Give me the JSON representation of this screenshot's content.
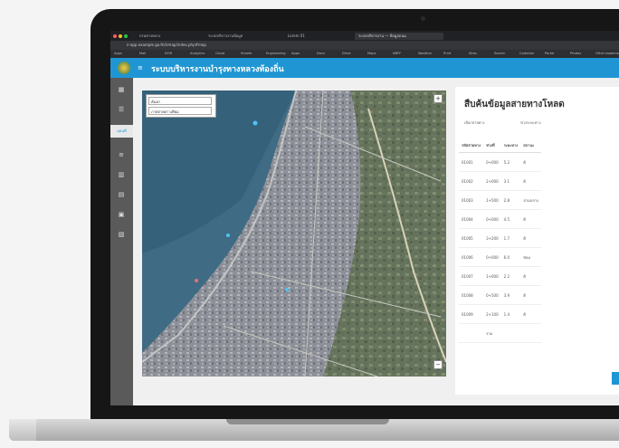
{
  "browser": {
    "tabs": [
      "กรมทางหลวง",
      "ระบบบริหารงานข้อมูล",
      "Lorem 01",
      "ระบบบริหารงาน — ข้อมูลถนน"
    ],
    "url": "ir-app.example.go.th/irmap/index.php#map",
    "bookmarks": [
      "Apps",
      "Mail",
      "DOH",
      "Analytics",
      "Cloud",
      "Sheets",
      "Engineering",
      "Apps",
      "Docs",
      "Drive",
      "Maps",
      "NRFF",
      "Weather",
      "Print",
      "Sites",
      "Search",
      "Calendar",
      "Portal",
      "Photos",
      "Other bookmarks"
    ]
  },
  "app": {
    "title": "ระบบบริหารงานบำรุงทางหลวงท้องถิ่น",
    "menu_icon": "hamburger-icon",
    "logo": "department-seal"
  },
  "sidebar": {
    "items": [
      {
        "icon": "home-icon",
        "glyph": "▦"
      },
      {
        "icon": "layers-icon",
        "glyph": "☰"
      },
      {
        "icon": "map-icon",
        "label": "แผนที่",
        "active": true
      },
      {
        "icon": "road-icon",
        "glyph": "≡"
      },
      {
        "icon": "chart-icon",
        "glyph": "▥"
      },
      {
        "icon": "document-icon",
        "glyph": "▤"
      },
      {
        "icon": "lock-icon",
        "glyph": "▣"
      },
      {
        "icon": "settings-icon",
        "glyph": "▧"
      }
    ]
  },
  "map": {
    "search_placeholder": "ค้นหา",
    "layer_label": "ภาพถ่ายดาวเทียม",
    "zoom_in": "+",
    "zoom_out": "−"
  },
  "panel": {
    "title": "สืบค้นข้อมูลสายทางโหลด",
    "filters": [
      "เลือกสายทาง",
      "ช่วงระยะทาง"
    ],
    "columns": [
      "รหัสสายทาง",
      "ช่วงที่",
      "ระยะทาง",
      "สถานะ"
    ],
    "rows": [
      [
        "01001",
        "0+000",
        "5.2",
        "ดี"
      ],
      [
        "01002",
        "2+000",
        "3.1",
        "ดี"
      ],
      [
        "01003",
        "1+500",
        "2.8",
        "ปานกลาง"
      ],
      [
        "01004",
        "0+000",
        "4.5",
        "ดี"
      ],
      [
        "01005",
        "3+200",
        "1.7",
        "ดี"
      ],
      [
        "01006",
        "0+000",
        "6.0",
        "ซ่อม"
      ],
      [
        "01007",
        "1+000",
        "2.2",
        "ดี"
      ],
      [
        "01008",
        "0+500",
        "3.9",
        "ดี"
      ],
      [
        "01009",
        "2+100",
        "1.4",
        "ดี"
      ],
      [
        "",
        "รวม",
        "",
        ""
      ]
    ]
  },
  "colors": {
    "accent": "#1f96d3",
    "sidebar": "#5a5a5a",
    "bezel": "#161616"
  }
}
